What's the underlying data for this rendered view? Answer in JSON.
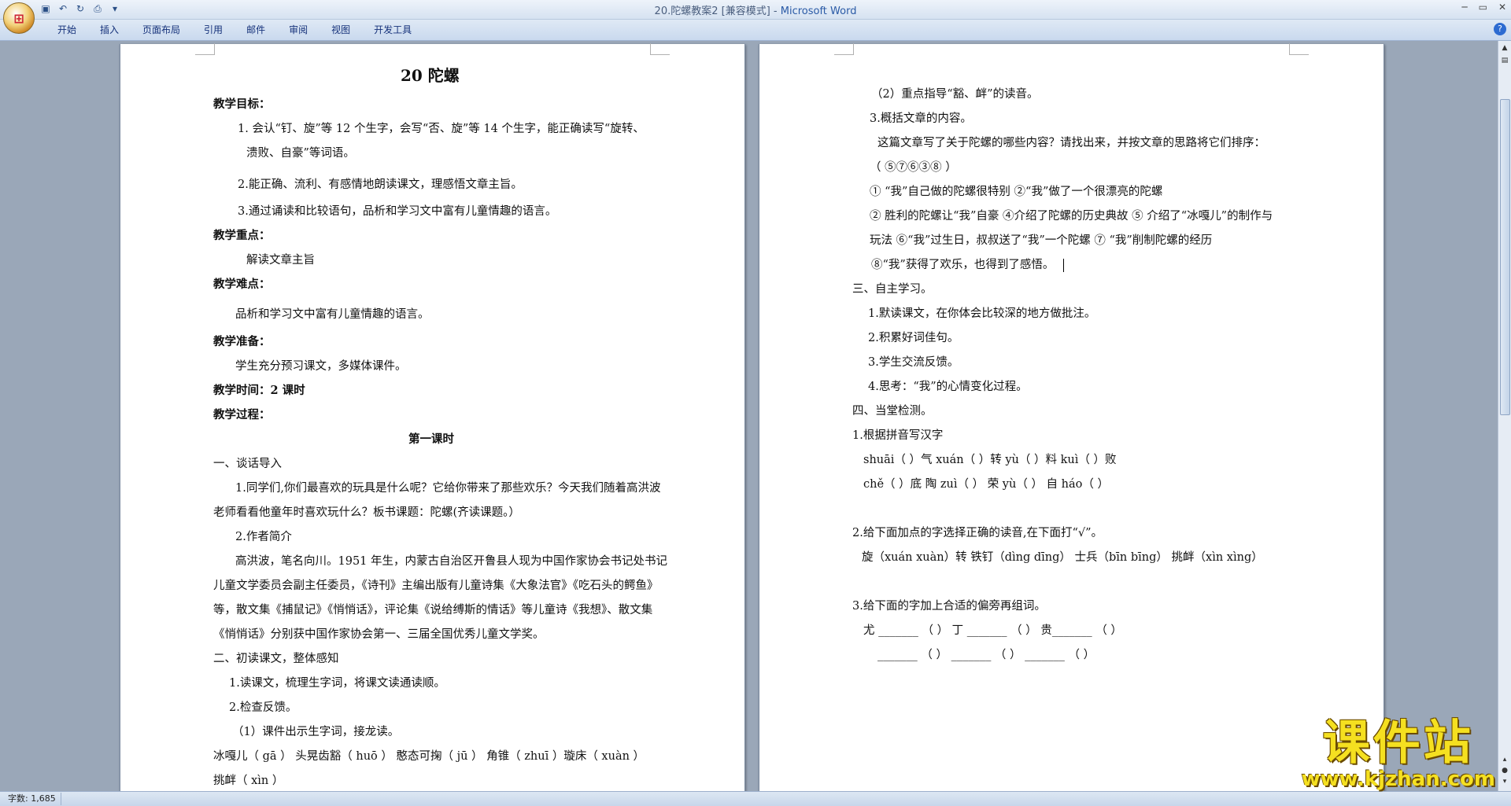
{
  "window": {
    "title_doc": "20.陀螺教案2 [兼容模式] - ",
    "title_app": "Microsoft Word"
  },
  "ribbon": {
    "tabs": [
      "开始",
      "插入",
      "页面布局",
      "引用",
      "邮件",
      "审阅",
      "视图",
      "开发工具"
    ]
  },
  "status": {
    "word_count": "字数: 1,685"
  },
  "watermark": {
    "big": "课件站",
    "small": "www.kjzhan.com"
  },
  "left_page": {
    "title": "20  陀螺",
    "lines": [
      "教学目标：",
      "1.    会认“钉、旋”等 12 个生字，会写“否、旋”等 14 个生字，能正确读写“旋转、",
      "溃败、自豪”等词语。",
      "2.能正确、流利、有感情地朗读课文，理感悟文章主旨。",
      "3.通过诵读和比较语句，品析和学习文中富有儿童情趣的语言。",
      "教学重点：",
      "解读文章主旨",
      "教学难点：",
      "品析和学习文中富有儿童情趣的语言。",
      "教学准备：",
      "学生充分预习课文，多媒体课件。",
      "教学时间：2 课时",
      "教学过程：",
      "第一课时",
      "一、谈话导入",
      "1.同学们,你们最喜欢的玩具是什么呢？它给你带来了那些欢乐？今天我们随着高洪波",
      "老师看看他童年时喜欢玩什么？板书课题：陀螺(齐读课题。）",
      "2.作者简介",
      "高洪波，笔名向川。1951 年生，内蒙古自治区开鲁县人现为中国作家协会书记处书记",
      "儿童文学委员会副主任委员，《诗刊》主编出版有儿童诗集《大象法官》《吃石头的鳄鱼》",
      "等，散文集《捕鼠记》《悄悄话》，评论集《说给缚斯的情话》等儿童诗《我想》、散文集",
      "《悄悄话》分别获中国作家协会第一、三届全国优秀儿童文学奖。",
      "二、初读课文，整体感知",
      "1.读课文，梳理生字词，将课文读通读顺。",
      "2.检查反馈。",
      "（1）课件出示生字词，接龙读。",
      "冰嘎儿（ gā ） 头晃齿豁（ huō ） 憨态可掬（ jū ）      角锥（ zhuī ）璇床（ xuàn ）",
      "挑衅（ xìn ）"
    ]
  },
  "right_page": {
    "lines": [
      "（2）重点指导“豁、衅”的读音。",
      "3.概括文章的内容。",
      "这篇文章写了关于陀螺的哪些内容？请找出来，并按文章的思路将它们排序：",
      "（ ⑤⑦⑥③⑧ ）",
      "①  “我”自己做的陀螺很特别 ②“我”做了一个很漂亮的陀螺",
      "② 胜利的陀螺让“我”自豪 ④介绍了陀螺的历史典故 ⑤ 介绍了“冰嘎儿”的制作与",
      "玩法 ⑥“我”过生日，叔叔送了“我”一个陀螺      ⑦ “我”削制陀螺的经历",
      "⑧“我”获得了欢乐，也得到了感悟。",
      "三、自主学习。",
      "1.默读课文，在你体会比较深的地方做批注。",
      "2.积累好词佳句。",
      "3.学生交流反馈。",
      "4.思考：“我”的心情变化过程。",
      "四、当堂检测。",
      "1.根据拼音写汉字",
      "shuāi（      ）气   xuán（      ）转    yù（      ）料     kuì（       ）败",
      "chě（      ）底      陶 zuì（      ）      荣 yù（      ）      自 háo（      ）",
      "2.给下面加点的字选择正确的读音,在下面打“√”。",
      "旋（xuán xuàn）转      铁钉（dìng dīng）    士兵（bīn bīng）  挑衅（xìn xìng）",
      "3.给下面的字加上合适的偏旁再组词。",
      "尤 _______ （        ）  丁 _______ （        ）  贵_______ （        ）",
      "_______ （        ）       _______ （        ）       _______ （        ）"
    ]
  }
}
